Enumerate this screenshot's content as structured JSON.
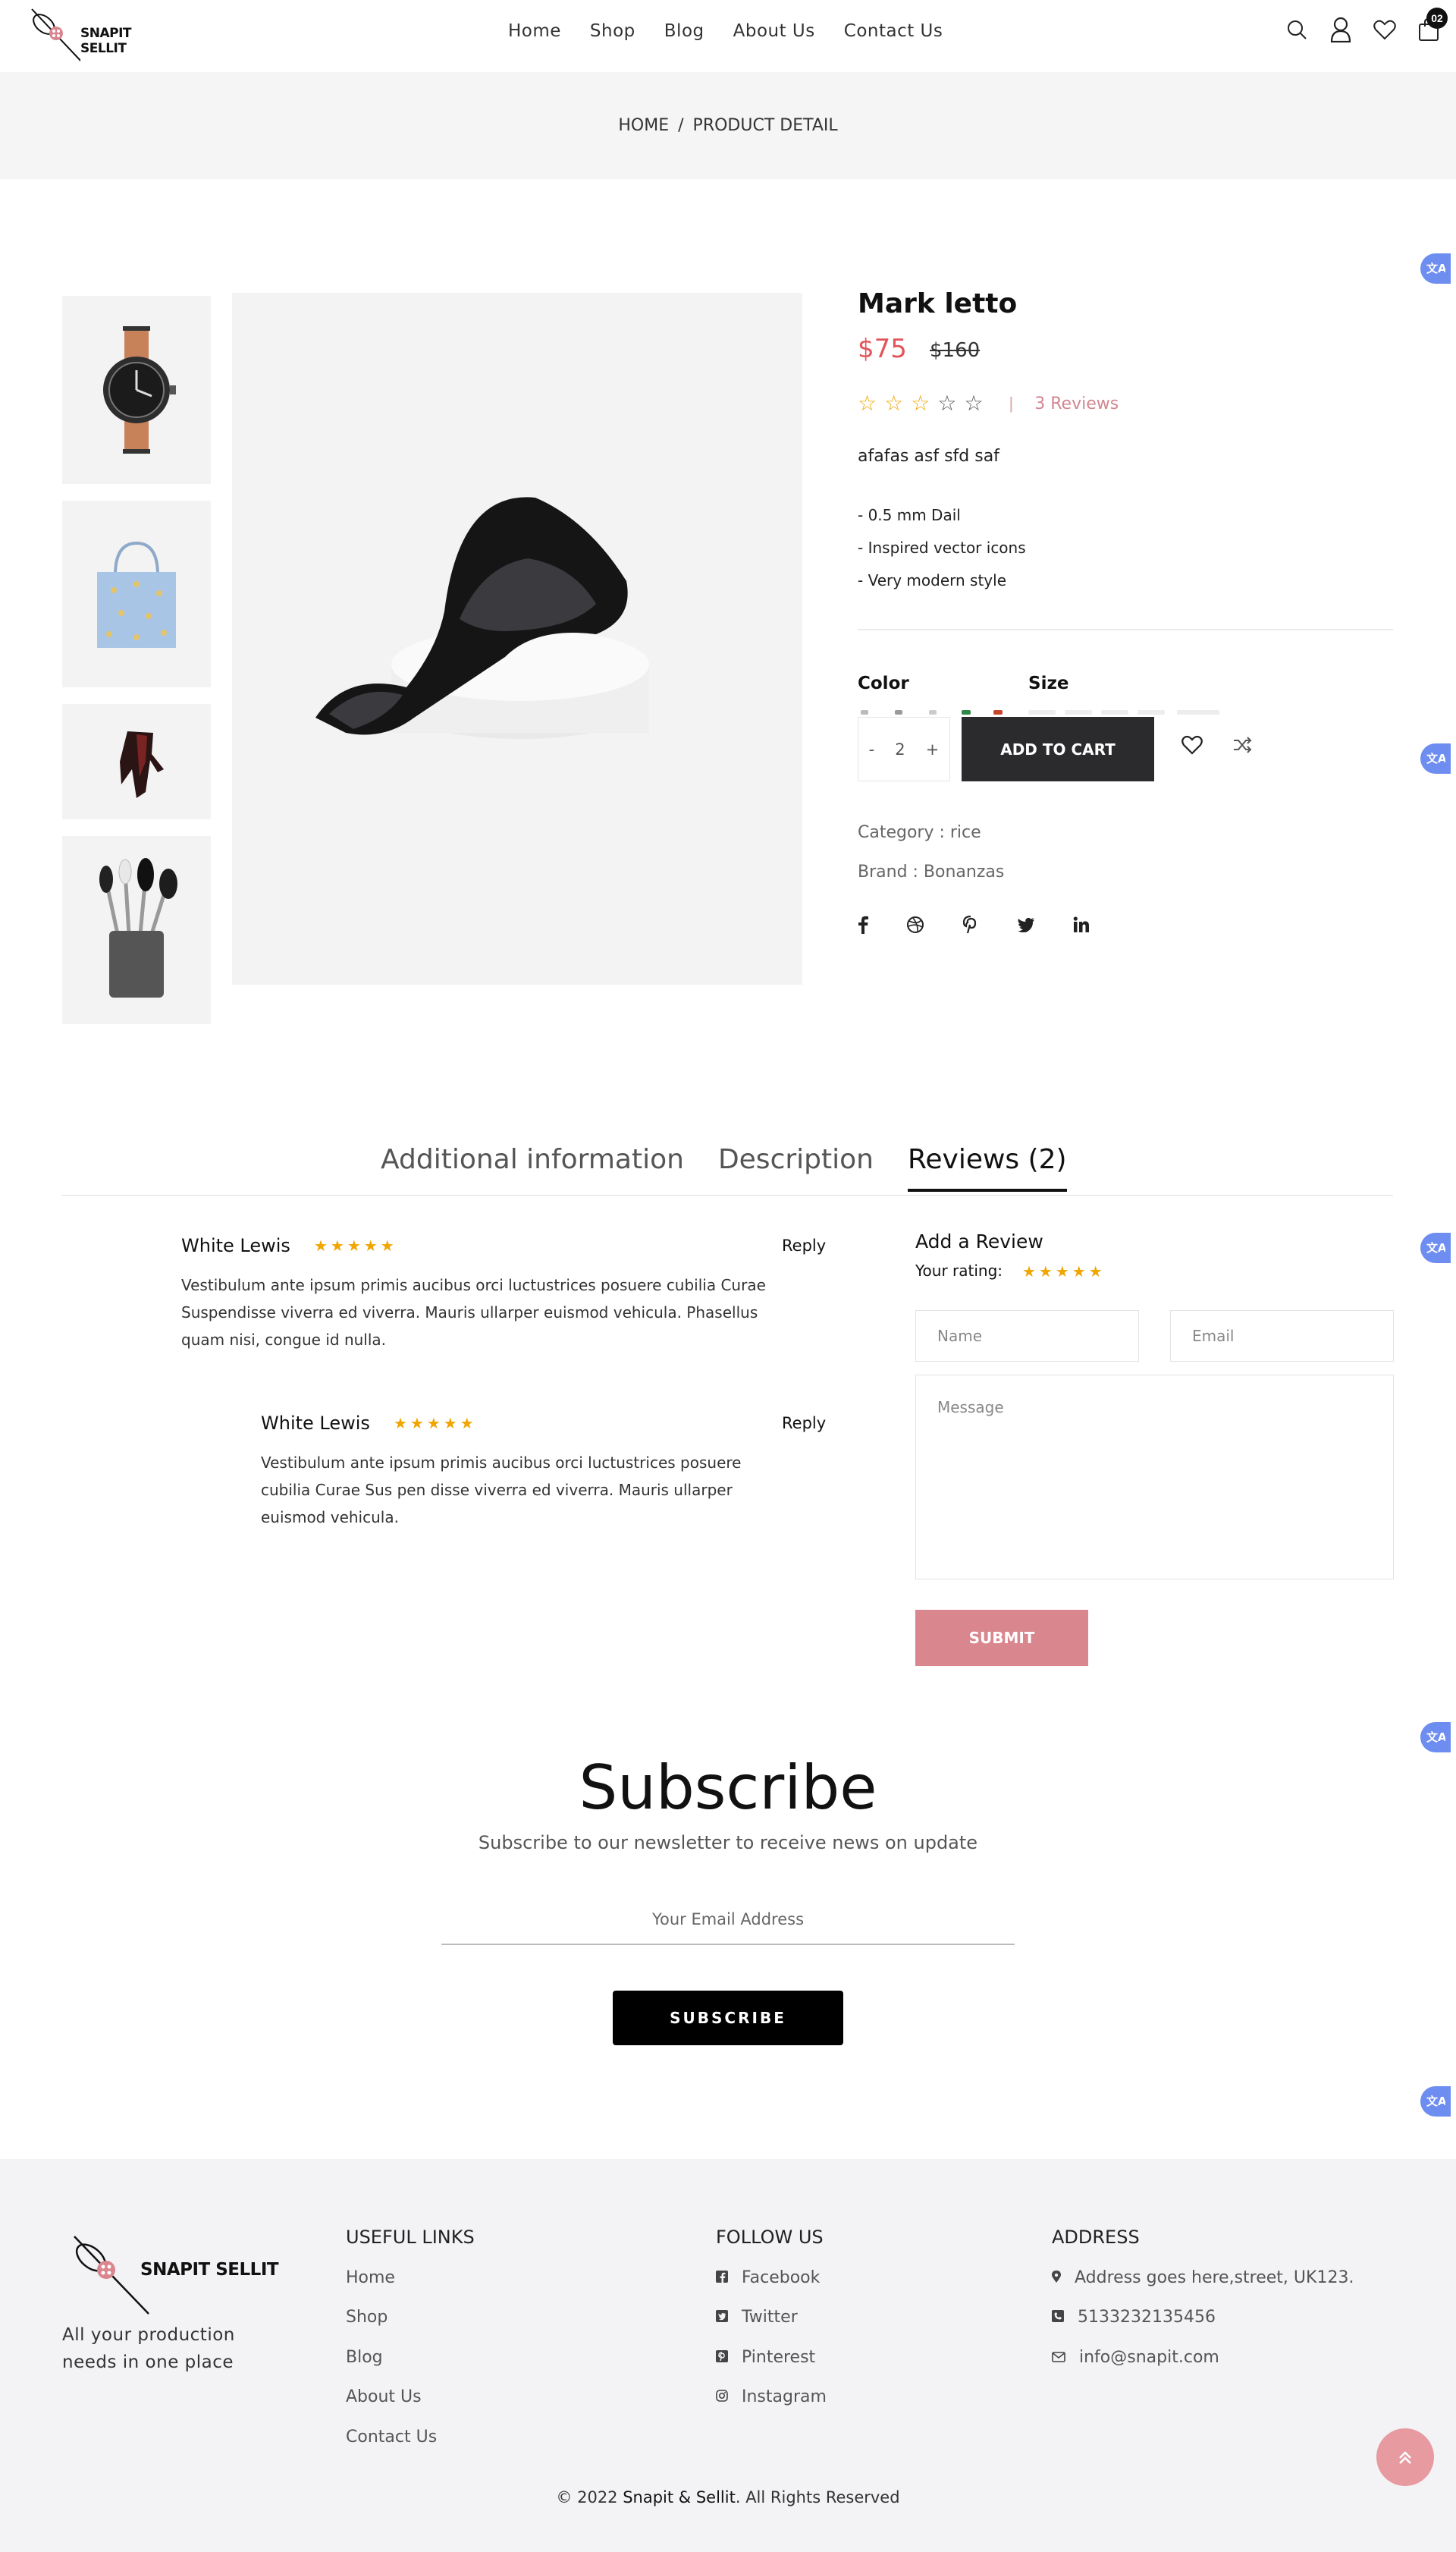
{
  "header": {
    "logo_text": "SNAPIT SELLIT",
    "nav": [
      "Home",
      "Shop",
      "Blog",
      "About Us",
      "Contact Us"
    ],
    "cart_count": "02"
  },
  "breadcrumb": {
    "home": "HOME",
    "sep": "/",
    "current": "PRODUCT DETAIL"
  },
  "translate_icon": "translate-icon",
  "product": {
    "title": "Mark letto",
    "price": "$75",
    "old_price": "$160",
    "rating": 3,
    "rating_max": 5,
    "reviews_link": "3 Reviews",
    "short_desc": "afafas  asf sfd saf",
    "features": [
      "- 0.5 mm Dail",
      "- Inspired vector icons",
      "- Very modern style"
    ],
    "color_label": "Color",
    "size_label": "Size",
    "qty_minus": "-",
    "qty": "2",
    "qty_plus": "+",
    "add_to_cart": "ADD TO CART",
    "category": "Category : rice",
    "brand": "Brand : Bonanzas",
    "accent": "#e2545b",
    "star_color": "#f0a500"
  },
  "tabs": [
    "Additional information",
    "Description",
    "Reviews (2)"
  ],
  "reviews": [
    {
      "name": "White Lewis",
      "stars": "★★★★★",
      "reply": "Reply",
      "text": "Vestibulum ante ipsum primis aucibus orci luctustrices posuere cubilia Curae Suspendisse viverra ed viverra. Mauris ullarper euismod vehicula. Phasellus quam nisi, congue id nulla."
    },
    {
      "name": "White Lewis",
      "stars": "★★★★★",
      "reply": "Reply",
      "text": "Vestibulum ante ipsum primis aucibus orci luctustrices posuere cubilia Curae Sus pen disse viverra ed viverra. Mauris ullarper euismod vehicula."
    }
  ],
  "review_form": {
    "title": "Add a Review",
    "your_rating": "Your rating:",
    "stars": "★★★★★",
    "name_placeholder": "Name",
    "email_placeholder": "Email",
    "message_placeholder": "Message",
    "submit": "SUBMIT",
    "submit_color": "#d9868f"
  },
  "subscribe": {
    "title": "Subscribe",
    "text": "Subscribe to our newsletter to receive news on update",
    "placeholder": "Your Email Address",
    "button": "SUBSCRIBE"
  },
  "footer": {
    "logo_text": "SNAPIT SELLIT",
    "tagline": "All your production needs in one place",
    "useful_links_title": "USEFUL LINKS",
    "useful_links": [
      "Home",
      "Shop",
      "Blog",
      "About Us",
      "Contact Us"
    ],
    "follow_title": "FOLLOW US",
    "follow": [
      "Facebook",
      "Twitter",
      "Pinterest",
      "Instagram"
    ],
    "address_title": "ADDRESS",
    "address": "Address goes here,street, UK123.",
    "phone": "5133232135456",
    "email": "info@snapit.com",
    "copyright_pre": "© 2022 ",
    "copyright_brand": "Snapit & Sellit",
    "copyright_post": ". All Rights Reserved"
  }
}
